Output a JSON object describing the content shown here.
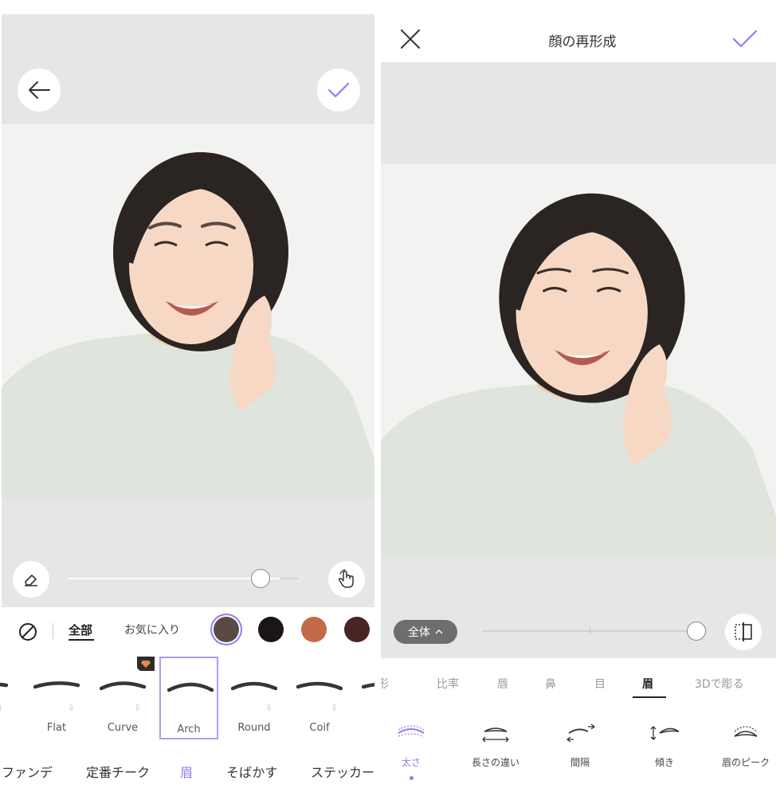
{
  "left": {
    "colors": {
      "tabs": {
        "all": "全部",
        "favorites": "お気に入り"
      },
      "swatches": [
        {
          "name": "brown-gray",
          "hex": "#5a4a44",
          "selected": true
        },
        {
          "name": "black",
          "hex": "#1a1616"
        },
        {
          "name": "terracotta",
          "hex": "#c46a48"
        },
        {
          "name": "dark-brown",
          "hex": "#4a2420"
        }
      ]
    },
    "slider": {
      "value": 0.92
    },
    "brows": [
      {
        "label": "l"
      },
      {
        "label": "Flat"
      },
      {
        "label": "Curve"
      },
      {
        "label": "Arch",
        "selected": true
      },
      {
        "label": "Round"
      },
      {
        "label": "Coif"
      },
      {
        "label": "Un"
      }
    ],
    "categories": [
      {
        "label": "ファンデ"
      },
      {
        "label": "定番チーク"
      },
      {
        "label": "眉",
        "active": true
      },
      {
        "label": "そばかす"
      },
      {
        "label": "ステッカー"
      }
    ]
  },
  "right": {
    "title": "顔の再形成",
    "scope_pill": "全体",
    "slider": {
      "value": 1.0
    },
    "feature_tabs": [
      {
        "label": "形"
      },
      {
        "label": "比率"
      },
      {
        "label": "唇"
      },
      {
        "label": "鼻"
      },
      {
        "label": "目"
      },
      {
        "label": "眉",
        "active": true
      },
      {
        "label": "3Dで彫る"
      }
    ],
    "tools": [
      {
        "label": "太さ",
        "active": true
      },
      {
        "label": "長さの違い"
      },
      {
        "label": "間隔"
      },
      {
        "label": "傾き"
      },
      {
        "label": "眉のピーク"
      }
    ]
  },
  "accent_color": "#8c7ef2"
}
